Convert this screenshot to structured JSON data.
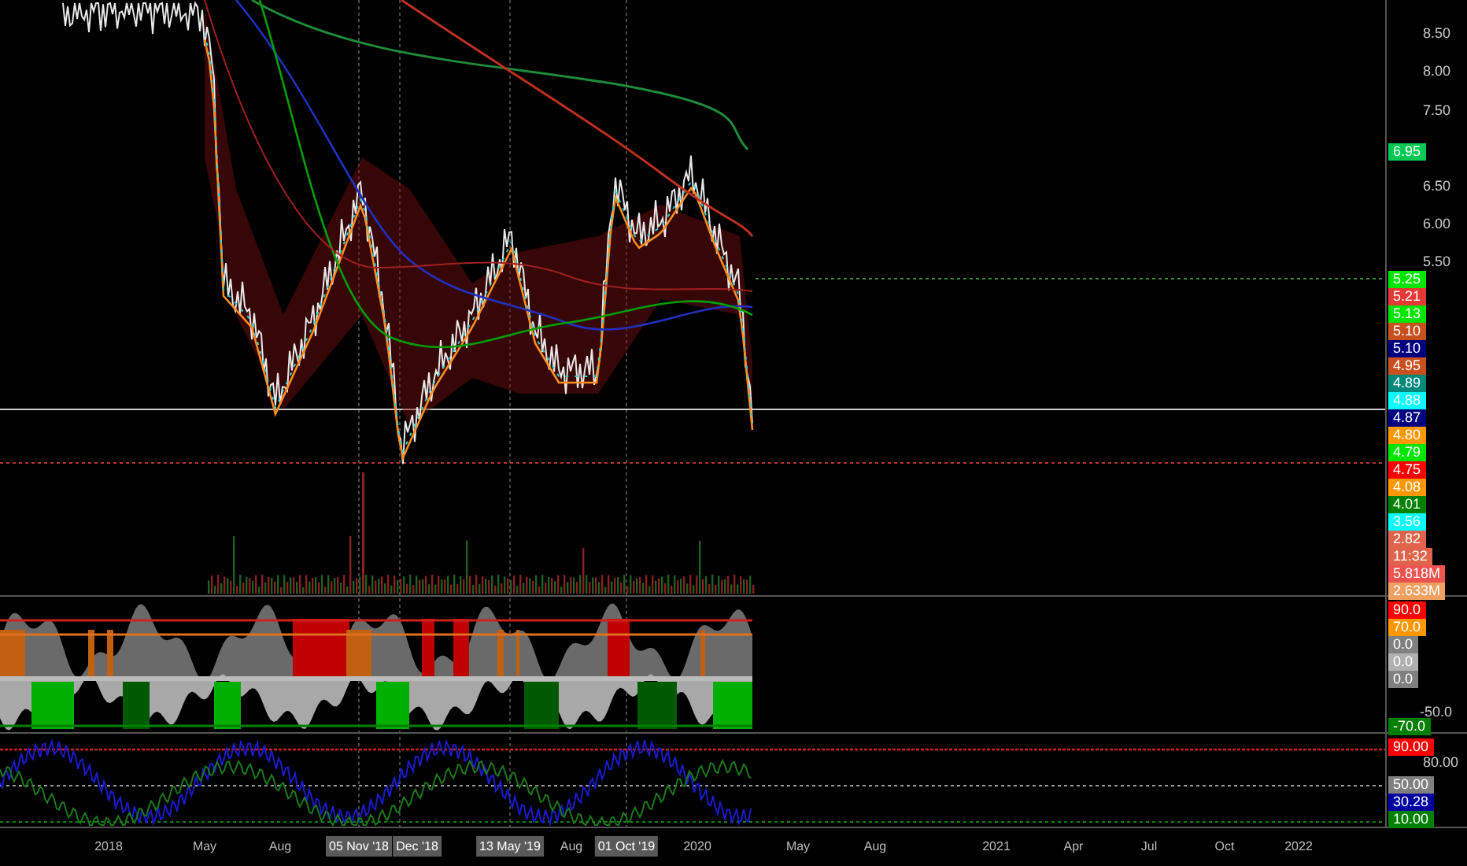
{
  "price_axis": {
    "ticks": [
      "8.50",
      "8.00",
      "7.50",
      "6.50",
      "6.00",
      "5.50"
    ],
    "badges": [
      {
        "text": "6.95",
        "color": "#00c853"
      },
      {
        "text": "5.25",
        "color": "#00e600"
      },
      {
        "text": "5.21",
        "color": "#e53935"
      },
      {
        "text": "5.13",
        "color": "#00e600"
      },
      {
        "text": "5.10",
        "color": "#c8501e"
      },
      {
        "text": "5.10",
        "color": "#000080"
      },
      {
        "text": "4.95",
        "color": "#c8501e"
      },
      {
        "text": "4.89",
        "color": "#00897b"
      },
      {
        "text": "4.88",
        "color": "#00ffff"
      },
      {
        "text": "4.87",
        "color": "#000080"
      },
      {
        "text": "4.80",
        "color": "#ff9800"
      },
      {
        "text": "4.79",
        "color": "#00e600"
      },
      {
        "text": "4.75",
        "color": "#ff0000"
      },
      {
        "text": "4.08",
        "color": "#ff9800"
      },
      {
        "text": "4.01",
        "color": "#008000"
      },
      {
        "text": "3.56",
        "color": "#00ffff"
      },
      {
        "text": "2.82",
        "color": "#e0644c"
      },
      {
        "text": "11:32",
        "color": "#e0644c"
      },
      {
        "text": "5.818M",
        "color": "#ef5350"
      },
      {
        "text": "2.633M",
        "color": "#f0a060"
      }
    ]
  },
  "oscillator_axis": {
    "ticks": [
      "-50.0"
    ],
    "badges": [
      {
        "text": "90.0",
        "color": "#ff0000"
      },
      {
        "text": "70.0",
        "color": "#ff9800"
      },
      {
        "text": "0.0",
        "color": "#808080"
      },
      {
        "text": "0.0",
        "color": "#b0b0b0"
      },
      {
        "text": "0.0",
        "color": "#808080"
      },
      {
        "text": "-70.0",
        "color": "#008000"
      }
    ]
  },
  "stochastic_axis": {
    "ticks": [
      "80.00"
    ],
    "badges": [
      {
        "text": "90.00",
        "color": "#ff0000"
      },
      {
        "text": "50.00",
        "color": "#808080"
      },
      {
        "text": "30.28",
        "color": "#0000a0"
      },
      {
        "text": "10.00",
        "color": "#008000"
      }
    ]
  },
  "time_axis": {
    "labels": [
      {
        "text": "2018",
        "highlighted": false
      },
      {
        "text": "May",
        "highlighted": false
      },
      {
        "text": "Aug",
        "highlighted": false
      },
      {
        "text": "05 Nov '18",
        "highlighted": true
      },
      {
        "text": "Dec '18",
        "highlighted": true
      },
      {
        "text": "13 May '19",
        "highlighted": true
      },
      {
        "text": "Aug",
        "highlighted": false
      },
      {
        "text": "01 Oct '19",
        "highlighted": true
      },
      {
        "text": "2020",
        "highlighted": false
      },
      {
        "text": "May",
        "highlighted": false
      },
      {
        "text": "Aug",
        "highlighted": false
      },
      {
        "text": "2021",
        "highlighted": false
      },
      {
        "text": "Apr",
        "highlighted": false
      },
      {
        "text": "Jul",
        "highlighted": false
      },
      {
        "text": "Oct",
        "highlighted": false
      },
      {
        "text": "2022",
        "highlighted": false
      }
    ]
  }
}
